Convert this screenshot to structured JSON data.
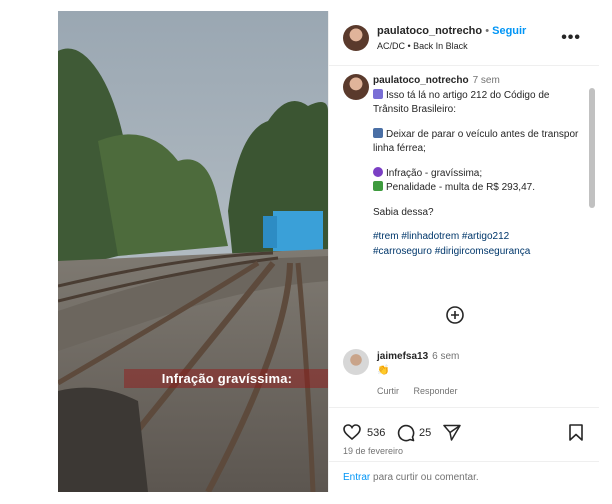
{
  "post": {
    "username": "paulatoco_notrecho",
    "separator": "•",
    "follow_label": "Seguir",
    "audio": "AC/DC • Back In Black",
    "overlay_text": "Infração gravíssima:"
  },
  "caption": {
    "username": "paulatoco_notrecho",
    "time": "7 sem",
    "lines": [
      "Isso tá lá no artigo 212 do Código de Trânsito Brasileiro:",
      "Deixar de parar o veículo antes de transpor linha férrea;",
      "Infração - gravíssima;",
      "Penalidade - multa de R$ 293,47.",
      "Sabia dessa?"
    ],
    "hashtags_1": "#trem #linhadotrem #artigo212",
    "hashtags_2": "#carroseguro #dirigircomsegurança"
  },
  "comment": {
    "username": "jaimefsa13",
    "time": "6 sem",
    "text": "👏",
    "reply_actions": [
      "Curtir",
      "Responder"
    ]
  },
  "stats": {
    "likes": "536",
    "comments": "25",
    "date": "19 de fevereiro"
  },
  "comment_box": {
    "login": "Entrar",
    "rest": "para curtir ou comentar."
  },
  "icons": [
    "heart-icon",
    "comment-icon",
    "share-icon",
    "bookmark-icon",
    "more-options-icon",
    "mute-icon",
    "add-comments-icon"
  ],
  "colors": {
    "link": "#0095f6",
    "hashtag": "#00376b",
    "muted": "#737373"
  }
}
